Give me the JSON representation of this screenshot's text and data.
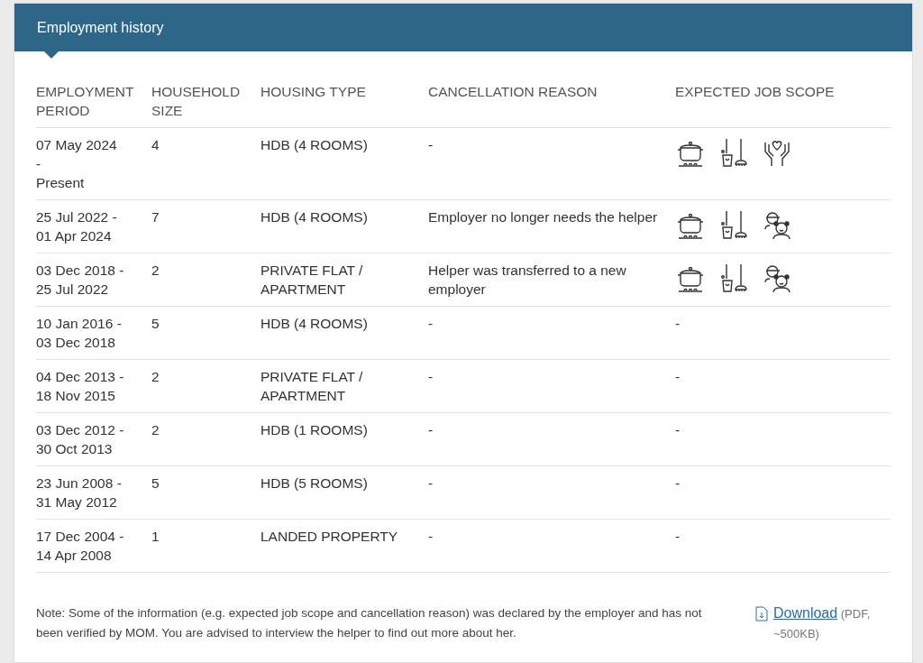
{
  "panel": {
    "title": "Employment history"
  },
  "table": {
    "columns": [
      "EMPLOYMENT PERIOD",
      "HOUSEHOLD SIZE",
      "HOUSING TYPE",
      "CANCELLATION REASON",
      "EXPECTED JOB SCOPE"
    ],
    "rows": [
      {
        "period": [
          "07 May 2024",
          "-",
          "Present"
        ],
        "household_size": "4",
        "housing_type": "HDB (4 ROOMS)",
        "cancellation_reason": "-",
        "job_scope": [
          {
            "kind": "cooking"
          },
          {
            "kind": "cleaning"
          },
          {
            "kind": "caregiving"
          }
        ]
      },
      {
        "period": [
          "25 Jul 2022 -",
          "01 Apr 2024"
        ],
        "household_size": "7",
        "housing_type": "HDB (4 ROOMS)",
        "cancellation_reason": "Employer no longer needs the helper",
        "job_scope": [
          {
            "kind": "cooking"
          },
          {
            "kind": "cleaning"
          },
          {
            "kind": "childcare"
          }
        ]
      },
      {
        "period": [
          "03 Dec 2018 -",
          "25 Jul 2022"
        ],
        "household_size": "2",
        "housing_type": "PRIVATE FLAT / APARTMENT",
        "cancellation_reason": "Helper was transferred to a new employer",
        "job_scope": [
          {
            "kind": "cooking"
          },
          {
            "kind": "cleaning"
          },
          {
            "kind": "childcare"
          }
        ]
      },
      {
        "period": [
          "10 Jan 2016 -",
          "03 Dec 2018"
        ],
        "household_size": "5",
        "housing_type": "HDB (4 ROOMS)",
        "cancellation_reason": "-",
        "job_scope_text": "-"
      },
      {
        "period": [
          "04 Dec 2013 -",
          "18 Nov 2015"
        ],
        "household_size": "2",
        "housing_type": "PRIVATE FLAT / APARTMENT",
        "cancellation_reason": "-",
        "job_scope_text": "-"
      },
      {
        "period": [
          "03 Dec 2012 -",
          "30 Oct 2013"
        ],
        "household_size": "2",
        "housing_type": "HDB (1 ROOMS)",
        "cancellation_reason": "-",
        "job_scope_text": "-"
      },
      {
        "period": [
          "23 Jun 2008 -",
          "31 May 2012"
        ],
        "household_size": "5",
        "housing_type": "HDB (5 ROOMS)",
        "cancellation_reason": "-",
        "job_scope_text": "-"
      },
      {
        "period": [
          "17 Dec 2004 -",
          "14 Apr 2008"
        ],
        "household_size": "1",
        "housing_type": "LANDED PROPERTY",
        "cancellation_reason": "-",
        "job_scope_text": "-"
      }
    ]
  },
  "note": "Note: Some of the information (e.g. expected job scope and cancellation reason) was declared by the employer and has not been verified by MOM. You are advised to interview the helper to find out more about her.",
  "download": {
    "label": "Download",
    "info": "(PDF, ~500KB)"
  }
}
